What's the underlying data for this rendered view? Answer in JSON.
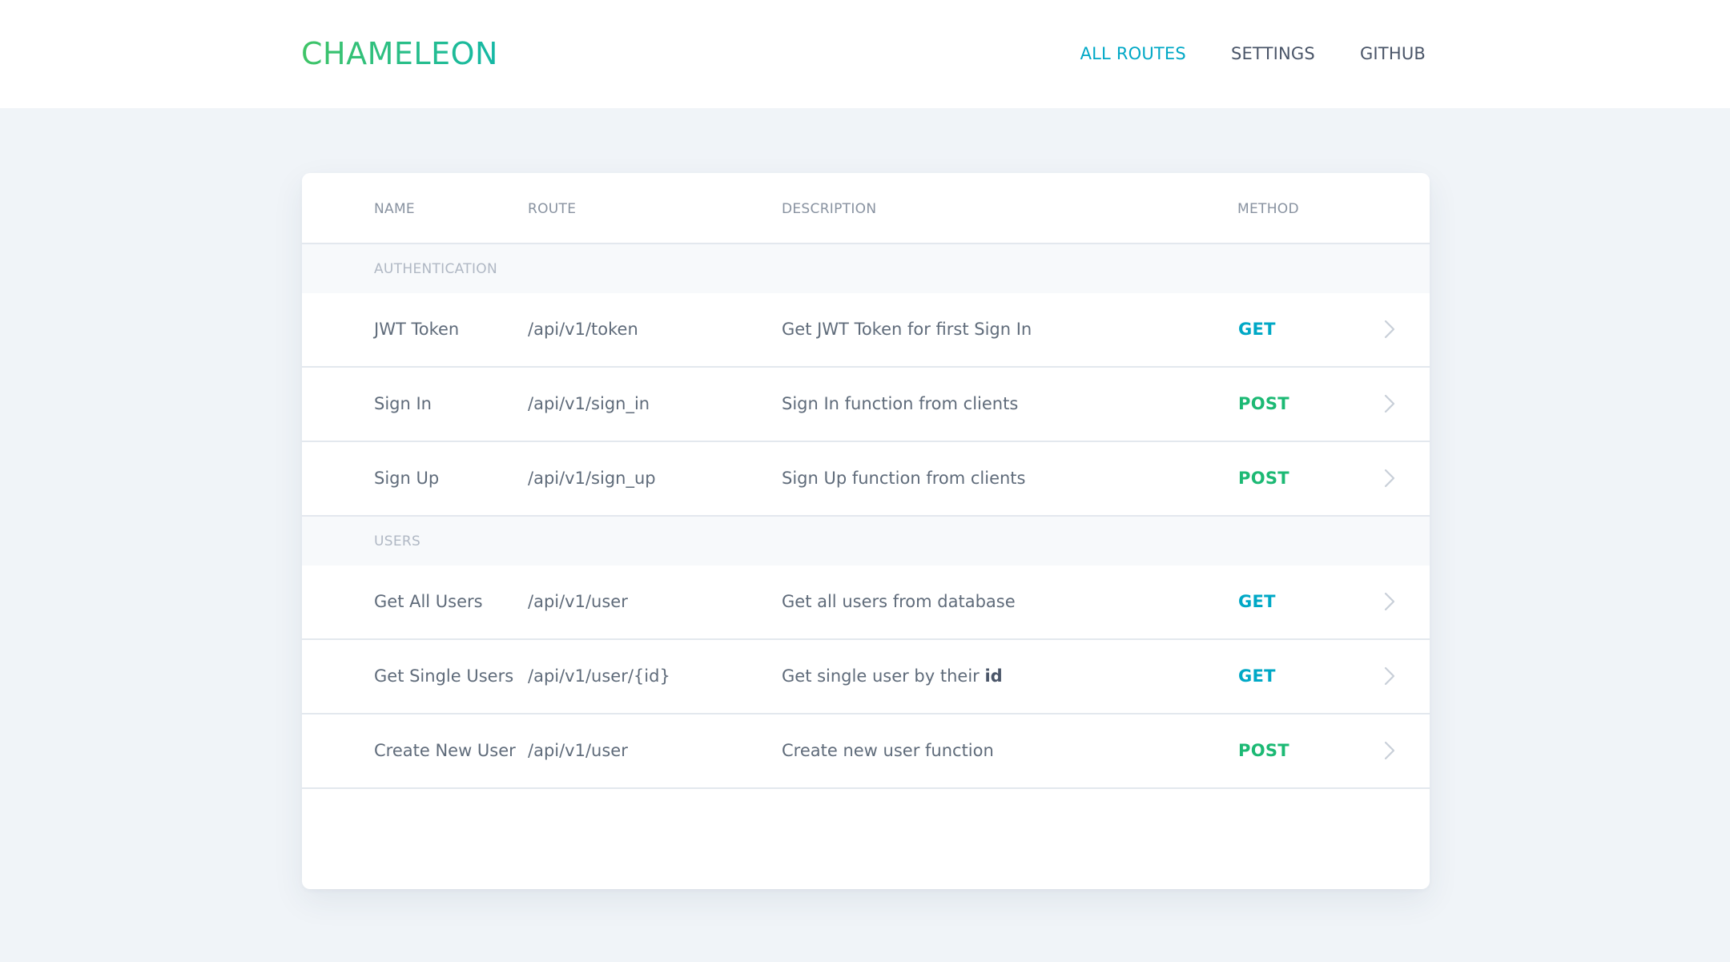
{
  "header": {
    "brand": "CHAMELEON",
    "nav": [
      {
        "label": "ALL ROUTES",
        "active": true
      },
      {
        "label": "SETTINGS",
        "active": false
      },
      {
        "label": "GITHUB",
        "active": false
      }
    ]
  },
  "table": {
    "columns": {
      "name": "NAME",
      "route": "ROUTE",
      "description": "DESCRIPTION",
      "method": "METHOD"
    },
    "groups": [
      {
        "label": "AUTHENTICATION",
        "rows": [
          {
            "name": "JWT Token",
            "route": "/api/v1/token",
            "description": "Get JWT Token for first Sign In",
            "method": "GET"
          },
          {
            "name": "Sign In",
            "route": "/api/v1/sign_in",
            "description": "Sign In function from clients",
            "method": "POST"
          },
          {
            "name": "Sign Up",
            "route": "/api/v1/sign_up",
            "description": "Sign Up function from clients",
            "method": "POST"
          }
        ]
      },
      {
        "label": "USERS",
        "rows": [
          {
            "name": "Get All Users",
            "route": "/api/v1/user",
            "description": "Get all users from database",
            "method": "GET"
          },
          {
            "name": "Get Single Users",
            "route": "/api/v1/user/{id}",
            "description": "Get single user by their",
            "description_emphasis": "id",
            "method": "GET"
          },
          {
            "name": "Create New User",
            "route": "/api/v1/user",
            "description": "Create new user function",
            "method": "POST"
          }
        ]
      }
    ]
  },
  "colors": {
    "brand_start": "#3fc466",
    "brand_end": "#14b8a6",
    "active_nav": "#00a8c6",
    "get": "#00a8c6",
    "post": "#1cb974",
    "background": "#f0f4f8"
  },
  "icons": {
    "row_action": "chevron-right-icon"
  }
}
